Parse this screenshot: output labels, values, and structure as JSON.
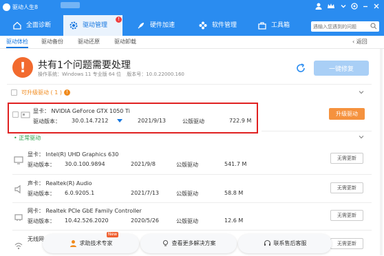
{
  "titlebar": {
    "title": "驱动人生8"
  },
  "nav": {
    "tabs": [
      {
        "label": "全面诊断",
        "icon": "home-icon"
      },
      {
        "label": "驱动管理",
        "icon": "gear-icon",
        "badge": "!"
      },
      {
        "label": "硬件加速",
        "icon": "rocket-icon"
      },
      {
        "label": "软件管理",
        "icon": "apps-icon"
      },
      {
        "label": "工具箱",
        "icon": "toolbox-icon"
      }
    ],
    "search_placeholder": "遇输入您遇到的问题"
  },
  "subnav": {
    "tabs": [
      "驱动体检",
      "驱动备份",
      "驱动还原",
      "驱动卸载"
    ],
    "back": "返回"
  },
  "header": {
    "title": "共有1个问题需要处理",
    "os": "操作系统：Windows 11 专业版 64 位",
    "version": "版本号：10.0.22000.160",
    "fix_button": "一键修复"
  },
  "upgradable": {
    "heading": "可升级驱动 ( 1 )",
    "info": "!",
    "device": {
      "label": "显卡：  NVIDIA GeForce GTX 1050 Ti",
      "version_label": "驱动版本：",
      "version": "30.0.14.7212",
      "date": "2021/9/13",
      "type": "公版驱动",
      "size": "722.9 M",
      "button": "升级驱动"
    }
  },
  "normal": {
    "heading": "正常驱动",
    "devices": [
      {
        "label": "显卡：  Intel(R) UHD Graphics 630",
        "version_label": "驱动版本：",
        "version": "30.0.100.9894",
        "date": "2021/9/8",
        "type": "公版驱动",
        "size": "541.7 M",
        "button": "无需更新",
        "icon": "display-icon"
      },
      {
        "label": "声卡：  Realtek(R) Audio",
        "version_label": "驱动版本：",
        "version": "6.0.9205.1",
        "date": "2021/7/13",
        "type": "公版驱动",
        "size": "58.8 M",
        "button": "无需更新",
        "icon": "speaker-icon"
      },
      {
        "label": "网卡：  Realtek PCIe GbE Family Controller",
        "version_label": "驱动版本：",
        "version": "10.42.526.2020",
        "date": "2020/5/26",
        "type": "公版驱动",
        "size": "12.6 M",
        "button": "无需更新",
        "icon": "network-icon"
      },
      {
        "label": "无线网卡",
        "button": "无需更新",
        "icon": "wifi-icon"
      }
    ]
  },
  "bottom": {
    "help": "求助技术专家",
    "help_tag": "New",
    "solutions": "查看更多解决方案",
    "contact": "联系售后客服"
  }
}
